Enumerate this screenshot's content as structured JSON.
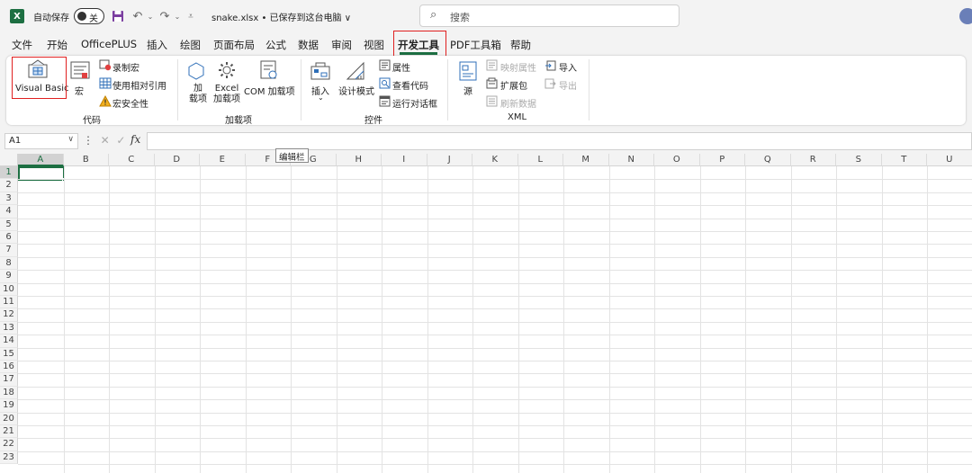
{
  "titlebar": {
    "autosave_label": "自动保存",
    "toggle_text": "关",
    "filename": "snake.xlsx • 已保存到这台电脑 ∨",
    "search_placeholder": "搜索",
    "excel_logo": "X"
  },
  "menu": {
    "tabs": [
      "文件",
      "开始",
      "OfficePLUS",
      "插入",
      "绘图",
      "页面布局",
      "公式",
      "数据",
      "审阅",
      "视图",
      "开发工具",
      "PDF工具箱",
      "帮助"
    ],
    "active": "开发工具"
  },
  "ribbon": {
    "code": {
      "visual_basic": "Visual Basic",
      "macro": "宏",
      "record_macro": "录制宏",
      "relative_ref": "使用相对引用",
      "macro_security": "宏安全性",
      "group": "代码"
    },
    "addins": {
      "addin": "加\n载项",
      "excel_addin": "Excel\n加载项",
      "com_addin": "COM 加载项",
      "group": "加载项"
    },
    "controls": {
      "insert": "插入",
      "design_mode": "设计模式",
      "properties": "属性",
      "view_code": "查看代码",
      "run_dialog": "运行对话框",
      "group": "控件"
    },
    "xml": {
      "source": "源",
      "map_props": "映射属性",
      "expansion": "扩展包",
      "refresh": "刷新数据",
      "import": "导入",
      "export": "导出",
      "group": "XML"
    }
  },
  "formula": {
    "namebox": "A1",
    "fx": "fx",
    "tooltip": "编辑栏"
  },
  "grid": {
    "columns": [
      "A",
      "B",
      "C",
      "D",
      "E",
      "F",
      "G",
      "H",
      "I",
      "J",
      "K",
      "L",
      "M",
      "N",
      "O",
      "P",
      "Q",
      "R",
      "S",
      "T",
      "U"
    ],
    "rows": [
      "1",
      "2",
      "3",
      "4",
      "5",
      "6",
      "7",
      "8",
      "9",
      "10",
      "11",
      "12",
      "13",
      "14",
      "15",
      "16",
      "17",
      "18",
      "19",
      "20",
      "21",
      "22",
      "23"
    ],
    "selected_cell": "A1"
  },
  "colors": {
    "accent": "#1d6f42",
    "highlight_box": "#e02020"
  }
}
